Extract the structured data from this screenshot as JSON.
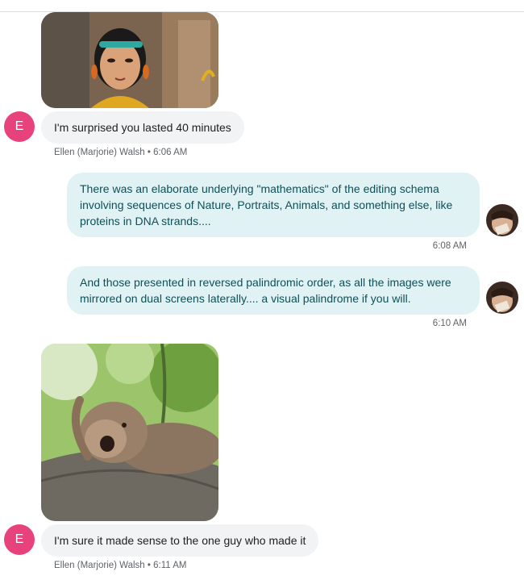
{
  "messages": [
    {
      "type": "image",
      "subject": "cartoon-woman-gif"
    },
    {
      "type": "text",
      "sender_initial": "E",
      "text": "I'm surprised you lasted 40 minutes"
    },
    {
      "type": "meta",
      "sender": "Ellen (Marjorie) Walsh",
      "time": "6:06 AM"
    },
    {
      "type": "text_out",
      "text": "There was an elaborate underlying \"mathematics\" of the editing schema involving sequences of Nature, Portraits, Animals, and something else, like proteins in DNA strands....",
      "time": "6:08 AM"
    },
    {
      "type": "text_out",
      "text": "And those presented in reversed palindromic order, as all the images were mirrored on dual screens laterally.... a visual palindrome if you will.",
      "time": "6:10 AM"
    },
    {
      "type": "image",
      "subject": "sleeping-monkey-gif"
    },
    {
      "type": "text",
      "sender_initial": "E",
      "text": "I'm sure it made sense to the one guy who made it"
    },
    {
      "type": "meta",
      "sender": "Ellen (Marjorie) Walsh",
      "time": "6:11 AM"
    }
  ],
  "meta_separator": "•",
  "colors": {
    "avatar_e": "#e8427c",
    "incoming_bubble": "#f1f3f4",
    "outgoing_bubble": "#e1f2f4",
    "outgoing_text": "#0f4f57"
  }
}
